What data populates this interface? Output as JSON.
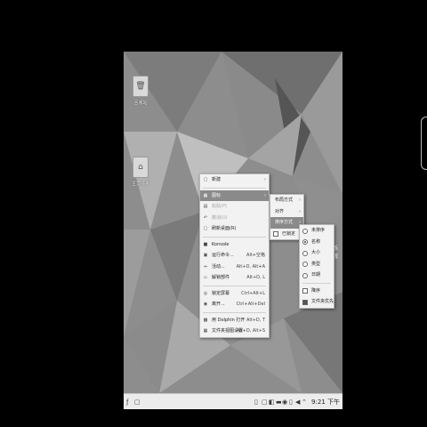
{
  "desktop": {
    "icons": [
      {
        "label": "回收站",
        "icon": "trash-icon"
      },
      {
        "label": "主文件夹",
        "icon": "home-folder-icon"
      }
    ],
    "partial_text": "系统"
  },
  "context_menu": {
    "items": [
      {
        "label": "新建",
        "icon": "document-icon",
        "submenu": true
      },
      {
        "label": "图标",
        "icon": "grid-icon",
        "submenu": true,
        "selected": true
      },
      {
        "label": "粘贴(P)",
        "icon": "paste-icon",
        "disabled": true
      },
      {
        "label": "撤消(U)",
        "icon": "undo-icon",
        "disabled": true
      },
      {
        "label": "刷新桌面(R)",
        "icon": "refresh-icon"
      },
      {
        "label": "Konsole",
        "icon": "terminal-icon"
      },
      {
        "label": "运行命令...",
        "icon": "run-icon",
        "shortcut": "Alt+空格"
      },
      {
        "label": "活动...",
        "icon": "activities-icon",
        "shortcut": "Alt+D, Alt+A"
      },
      {
        "label": "解锁部件",
        "icon": "unlock-icon",
        "shortcut": "Alt+D, L"
      },
      {
        "label": "锁定屏幕",
        "icon": "lock-icon",
        "shortcut": "Ctrl+Alt+L"
      },
      {
        "label": "离开...",
        "icon": "leave-icon",
        "shortcut": "Ctrl+Alt+Del"
      },
      {
        "label": "用 Dolphin 打开",
        "icon": "dolphin-icon",
        "shortcut": "Alt+D, T"
      },
      {
        "label": "文件夹视图设置",
        "icon": "settings-icon",
        "shortcut": "Alt+D, Alt+S"
      }
    ]
  },
  "icons_submenu": {
    "items": [
      {
        "label": "布局方式",
        "submenu": true
      },
      {
        "label": "对齐",
        "submenu": true
      },
      {
        "label": "排序方式",
        "submenu": true,
        "selected": true
      },
      {
        "label": "已锁定",
        "checked": false
      }
    ]
  },
  "sort_submenu": {
    "items": [
      {
        "label": "未排序",
        "checked": false
      },
      {
        "label": "名称",
        "checked": true
      },
      {
        "label": "大小",
        "checked": false
      },
      {
        "label": "类型",
        "checked": false
      },
      {
        "label": "日期",
        "checked": false
      }
    ],
    "options": [
      {
        "label": "降序",
        "checked": false
      },
      {
        "label": "文件夹优先",
        "checked": true
      }
    ]
  },
  "taskbar": {
    "clock": "9:21 下午"
  },
  "colors": {
    "selection": "#8a8a8a",
    "menu_bg": "#f2f2f2"
  }
}
